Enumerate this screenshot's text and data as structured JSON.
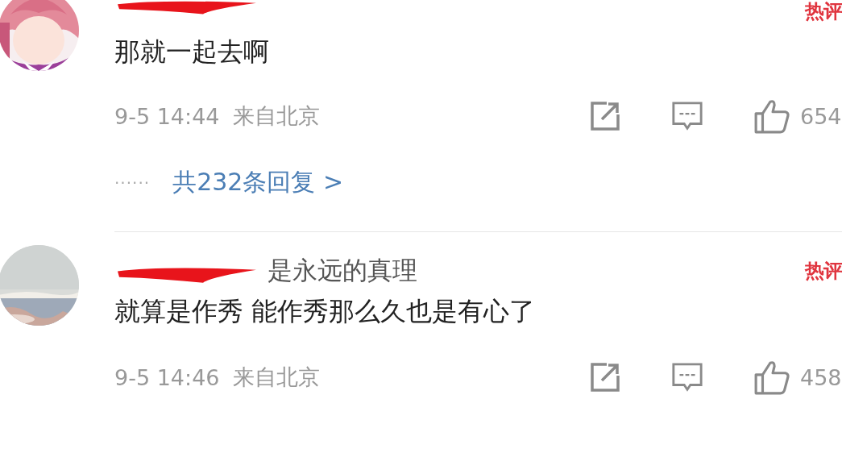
{
  "comments": [
    {
      "name_redacted": true,
      "badge": "热评",
      "text": "那就一起去啊",
      "time": "9-5 14:44",
      "location": "来自北京",
      "likes": "654",
      "replies": {
        "dots": "······",
        "label": "共232条回复 >"
      }
    },
    {
      "name_redacted": true,
      "username": "是永远的真理",
      "badge": "热评",
      "text": "就算是作秀 能作秀那么久也是有心了",
      "time": "9-5 14:46",
      "location": "来自北京",
      "likes": "458"
    }
  ]
}
